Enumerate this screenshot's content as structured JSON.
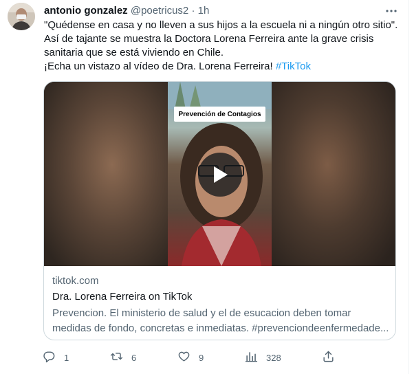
{
  "tweet": {
    "author_name": "antonio gonzalez",
    "handle": "@poetricus2",
    "separator": "·",
    "time": "1h",
    "text_lines": [
      "\"Quédense en casa y no lleven a sus hijos a la escuela ni a ningún otro sitio\".",
      "Así de tajante se muestra la Doctora Lorena Ferreira ante la grave crisis",
      "sanitaria que se está viviendo en Chile.",
      "¡Echa un vistazo al vídeo de Dra. Lorena Ferreira! "
    ],
    "hashtag": "#TikTok"
  },
  "card": {
    "video_overlay_label": "Prevención de Contagios",
    "domain": "tiktok.com",
    "title": "Dra. Lorena Ferreira on TikTok",
    "description_lines": [
      "Prevencion. El ministerio de salud y el de esucacion deben tomar",
      "medidas de fondo, concretas e inmediatas. #prevenciondeenfermedade..."
    ]
  },
  "actions": {
    "reply_count": "1",
    "retweet_count": "6",
    "like_count": "9",
    "views_count": "328"
  },
  "colors": {
    "accent": "#1d9bf0",
    "secondary_text": "#536471",
    "border": "#cfd9de"
  },
  "icons": [
    "more-icon",
    "play-icon",
    "reply-icon",
    "retweet-icon",
    "like-icon",
    "views-icon",
    "share-icon"
  ]
}
